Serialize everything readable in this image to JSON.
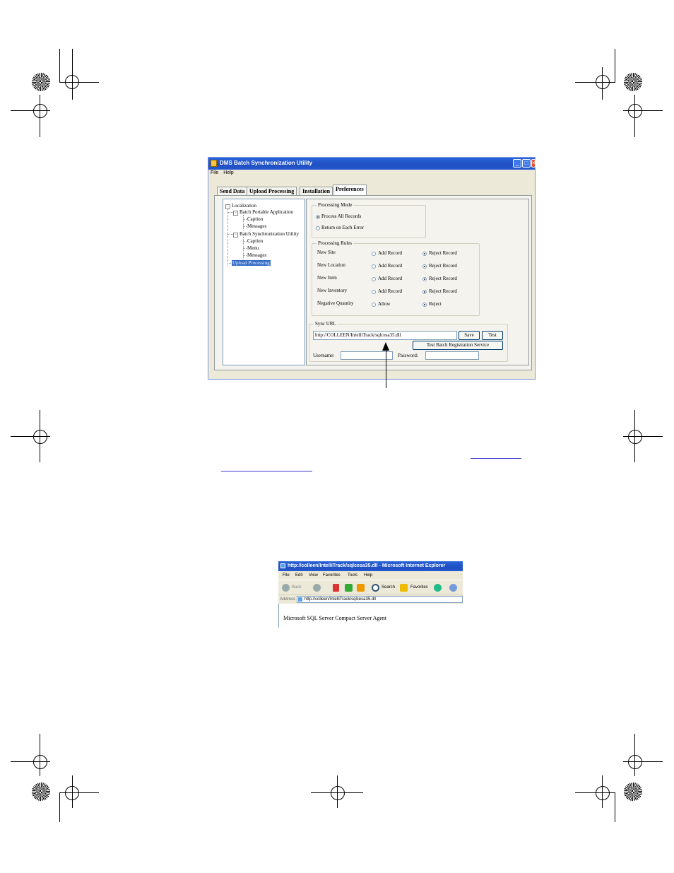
{
  "app": {
    "title": "DMS Batch Synchronization Utility",
    "menu": [
      "File",
      "Help"
    ],
    "tabs": [
      "Send Data",
      "Upload Processing",
      "Installation",
      "Preferences"
    ],
    "active_tab": "Preferences",
    "tree": {
      "root": "Localization",
      "bpa": "Batch Portable Application",
      "bpa_caption": "Caption",
      "bpa_messages": "Messages",
      "bsu": "Batch Synchronization Utility",
      "bsu_caption": "Caption",
      "bsu_menu": "Menu",
      "bsu_messages": "Messages",
      "upload": "Upload Processing"
    },
    "processing_mode": {
      "label": "Processing Mode",
      "option_all": "Process All Records",
      "option_error": "Return on Each Error",
      "selected": "Process All Records"
    },
    "processing_rules": {
      "label": "Processing Rules",
      "rows": [
        {
          "name": "New Site",
          "a": "Add Record",
          "b": "Reject Record",
          "selected": "b"
        },
        {
          "name": "New Location",
          "a": "Add Record",
          "b": "Reject Record",
          "selected": "b"
        },
        {
          "name": "New Item",
          "a": "Add Record",
          "b": "Reject Record",
          "selected": "b"
        },
        {
          "name": "New Inventory",
          "a": "Add Record",
          "b": "Reject Record",
          "selected": "b"
        },
        {
          "name": "Negative Quantity",
          "a": "Allow",
          "b": "Reject",
          "selected": "b"
        }
      ]
    },
    "sync_url": {
      "label": "Sync URL",
      "value": "http://COLLEEN/IntelliTrack/sqlcesa35.dll",
      "save": "Save",
      "test": "Test",
      "test_batch": "Test Batch Registration Service",
      "username_label": "Username:",
      "password_label": "Password:",
      "username_value": "",
      "password_value": ""
    }
  },
  "ie": {
    "title": "http://colleen/IntelliTrack/sqlcesa35.dll - Microsoft Internet Explorer",
    "menu": [
      "File",
      "Edit",
      "View",
      "Favorites",
      "Tools",
      "Help"
    ],
    "back": "Back",
    "search": "Search",
    "favorites": "Favorites",
    "address_label": "Address",
    "address": "http://colleen/IntelliTrack/sqlcesa35.dll",
    "body": "Microsoft SQL Server Compact Server Agent"
  }
}
